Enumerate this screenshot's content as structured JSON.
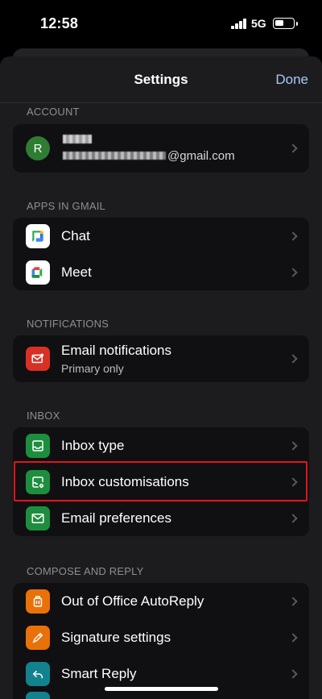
{
  "status": {
    "time": "12:58",
    "network": "5G"
  },
  "nav": {
    "title": "Settings",
    "done_label": "Done"
  },
  "account": {
    "header": "ACCOUNT",
    "avatar_initial": "R",
    "email_domain": "@gmail.com"
  },
  "apps": {
    "header": "APPS IN GMAIL",
    "items": [
      {
        "label": "Chat",
        "icon": "google-chat-icon"
      },
      {
        "label": "Meet",
        "icon": "google-meet-icon"
      }
    ]
  },
  "notifications": {
    "header": "NOTIFICATIONS",
    "email_label": "Email notifications",
    "email_sub": "Primary only"
  },
  "inbox": {
    "header": "INBOX",
    "items": [
      {
        "label": "Inbox type",
        "icon": "inbox-tray-icon"
      },
      {
        "label": "Inbox customisations",
        "icon": "inbox-settings-icon"
      },
      {
        "label": "Email preferences",
        "icon": "envelope-icon"
      }
    ]
  },
  "compose": {
    "header": "COMPOSE AND REPLY",
    "items": [
      {
        "label": "Out of Office AutoReply",
        "icon": "suitcase-icon"
      },
      {
        "label": "Signature settings",
        "icon": "pen-icon"
      },
      {
        "label": "Smart Reply",
        "icon": "reply-arrow-icon"
      }
    ]
  },
  "colors": {
    "green_icon": "#1e8e3e",
    "orange_icon": "#e8710a",
    "teal_icon": "#12828f",
    "red_icon": "#d93025",
    "highlight": "#e3141b",
    "done_blue": "#a9c7f7"
  }
}
